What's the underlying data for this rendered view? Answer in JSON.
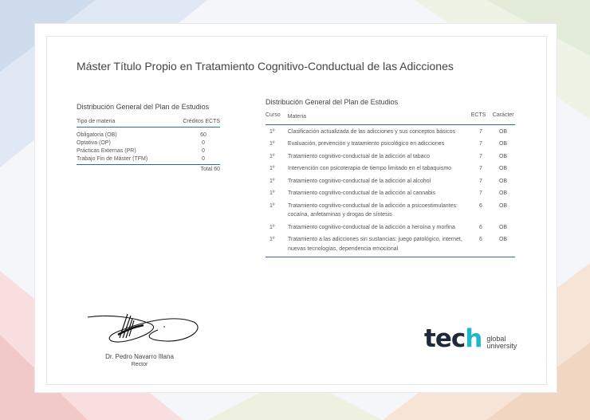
{
  "document": {
    "title": "Máster Título Propio en Tratamiento Cognitivo-Conductual de las Adicciones"
  },
  "distribution": {
    "title": "Distribución General del Plan de Estudios",
    "header_type": "Tipo de materia",
    "header_credits": "Créditos ECTS",
    "rows": [
      {
        "type": "Obligatoria (OB)",
        "credits": "60"
      },
      {
        "type": "Optativa (OP)",
        "credits": "0"
      },
      {
        "type": "Prácticas Externas (PR)",
        "credits": "0"
      },
      {
        "type": "Trabajo Fin de Máster (TFM)",
        "credits": "0"
      }
    ],
    "total": "Total 60"
  },
  "plan": {
    "title": "Distribución General del Plan de Estudios",
    "headers": {
      "curso": "Curso",
      "materia": "Materia",
      "ects": "ECTS",
      "caracter": "Carácter"
    },
    "rows": [
      {
        "curso": "1º",
        "materia": "Clasificación actualizada de las adicciones y sus conceptos básicos",
        "ects": "7",
        "caracter": "OB"
      },
      {
        "curso": "1º",
        "materia": "Evaluación, prevención y tratamiento psicológico en adicciones",
        "ects": "7",
        "caracter": "OB"
      },
      {
        "curso": "1º",
        "materia": "Tratamiento cognitivo-conductual de la adicción al tabaco",
        "ects": "7",
        "caracter": "OB"
      },
      {
        "curso": "1º",
        "materia": "Intervención con psicoterapia de tiempo limitado en el tabaquismo",
        "ects": "7",
        "caracter": "OB"
      },
      {
        "curso": "1º",
        "materia": "Tratamiento cognitivo-conductual de la adicción al alcohol",
        "ects": "7",
        "caracter": "OB"
      },
      {
        "curso": "1º",
        "materia": "Tratamiento cognitivo-conductual de la adicción al cannabis",
        "ects": "7",
        "caracter": "OB"
      },
      {
        "curso": "1º",
        "materia": "Tratamiento cognitivo-conductual de la adicción a psicoestimulantes: cocaína, anfetaminas y drogas de síntesis",
        "ects": "6",
        "caracter": "OB"
      },
      {
        "curso": "1º",
        "materia": "Tratamiento cognitivo-conductual de la adicción a heroína y morfina",
        "ects": "6",
        "caracter": "OB"
      },
      {
        "curso": "1º",
        "materia": "Tratamiento a las adicciones sin sustancias: juego patológico, internet, nuevas tecnologías, dependencia emocional",
        "ects": "6",
        "caracter": "OB"
      }
    ]
  },
  "signatory": {
    "name": "Dr. Pedro Navarro Illana",
    "role": "Rector"
  },
  "logo": {
    "word_start": "tec",
    "word_end": "h",
    "tag_line1": "global",
    "tag_line2": "university",
    "accent_color": "#21b7c9",
    "dark_color": "#1e2a3a"
  }
}
